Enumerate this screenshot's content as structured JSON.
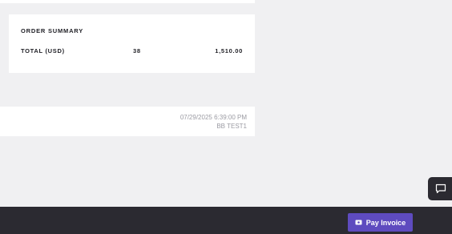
{
  "order_summary": {
    "title": "ORDER SUMMARY",
    "total_label": "TOTAL (USD)",
    "total_quantity": "38",
    "total_amount": "1,510.00"
  },
  "meta": {
    "datetime": "07/29/2025 6:39:00 PM",
    "user": "BB TEST1"
  },
  "footer": {
    "pay_button_label": "Pay Invoice",
    "pay_icon": "money-icon"
  },
  "chat": {
    "icon": "chat-bubble-icon"
  },
  "colors": {
    "background": "#f0f0f2",
    "card": "#ffffff",
    "footer": "#2b2a31",
    "accent": "#5e4bbf",
    "muted_text": "#9b9ba3"
  }
}
